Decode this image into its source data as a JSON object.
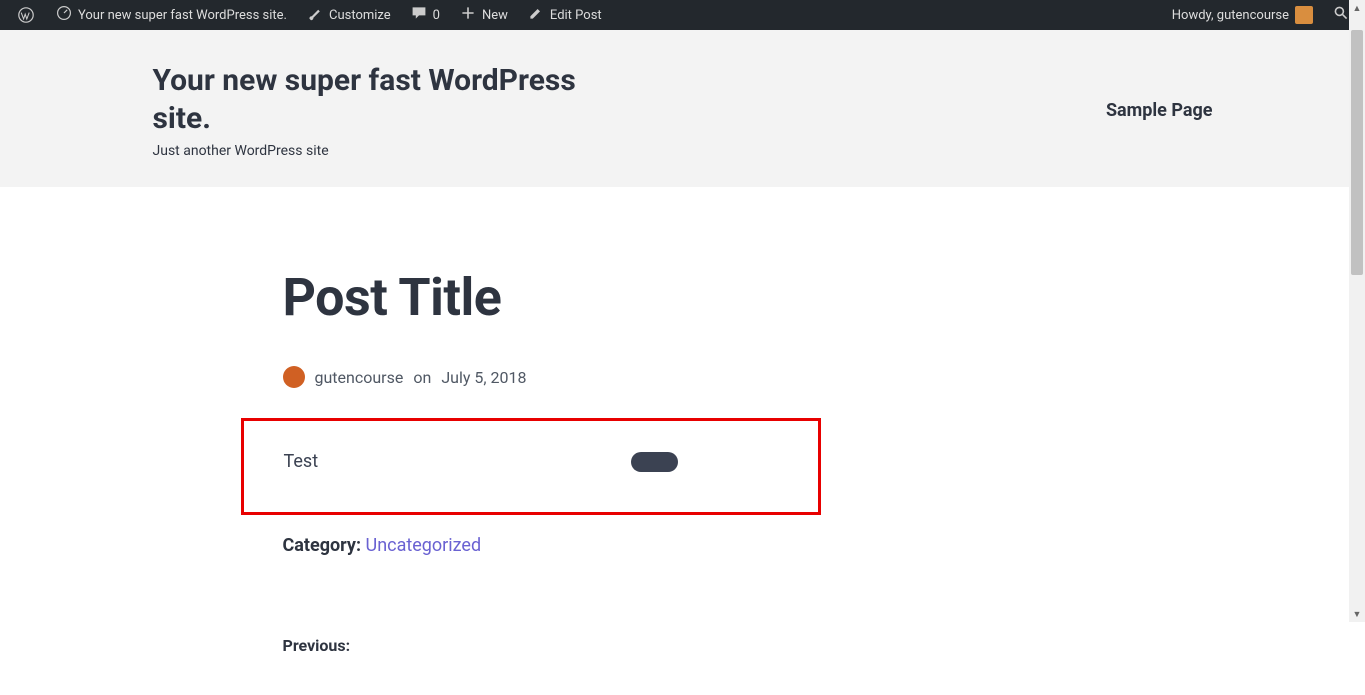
{
  "admin_bar": {
    "site_name": "Your new super fast WordPress site.",
    "customize": "Customize",
    "comments_count": "0",
    "new": "New",
    "edit_post": "Edit Post",
    "howdy": "Howdy, gutencourse"
  },
  "header": {
    "site_title": "Your new super fast WordPress site.",
    "tagline": "Just another WordPress site",
    "nav_item": "Sample Page"
  },
  "post": {
    "title": "Post Title",
    "author": "gutencourse",
    "on": "on",
    "date": "July 5, 2018",
    "test_text": "Test",
    "category_label": "Category:",
    "category_value": "Uncategorized",
    "previous_label": "Previous:"
  }
}
